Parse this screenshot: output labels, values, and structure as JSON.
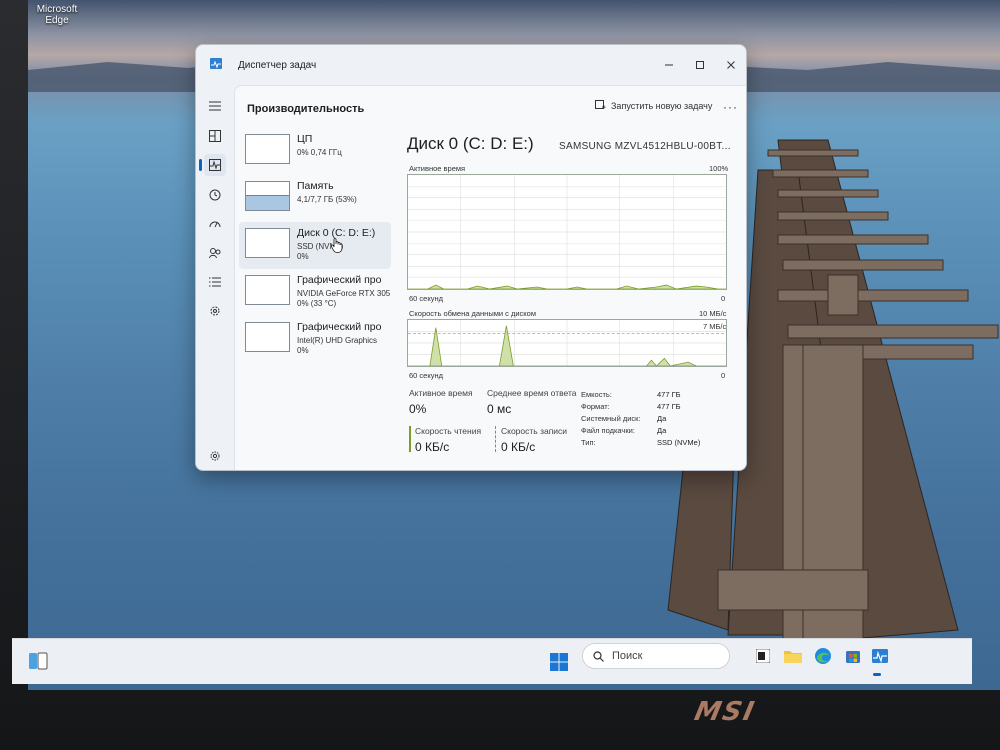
{
  "desktop": {
    "edge_label_1": "Microsoft",
    "edge_label_2": "Edge"
  },
  "taskmanager": {
    "title": "Диспетчер задач",
    "page_title": "Производительность",
    "run_task": "Запустить новую задачу",
    "more": "···",
    "resources": [
      {
        "name": "ЦП",
        "sub1": "0% 0,74 ГГц",
        "sub2": ""
      },
      {
        "name": "Память",
        "sub1": "4,1/7,7 ГБ (53%)",
        "sub2": "",
        "fill_fraction": 0.53
      },
      {
        "name": "Диск 0 (C: D: E:)",
        "sub1": "SSD (NVMe)",
        "sub2": "0%"
      },
      {
        "name": "Графический про",
        "sub1": "NVIDIA GeForce RTX 305",
        "sub2": "0%  (33 °C)"
      },
      {
        "name": "Графический про",
        "sub1": "Intel(R) UHD Graphics",
        "sub2": "0%"
      }
    ],
    "disk": {
      "title": "Диск 0 (C: D: E:)",
      "model": "SAMSUNG MZVL4512HBLU-00BT...",
      "graph1_label": "Активное время",
      "graph1_max": "100%",
      "graph1_xleft": "60 секунд",
      "graph1_xright": "0",
      "graph2_label": "Скорость обмена данными с диском",
      "graph2_max": "10 МБ/с",
      "graph2_sub": "7 МБ/с",
      "graph2_xleft": "60 секунд",
      "graph2_xright": "0",
      "active_time_label": "Активное время",
      "active_time_value": "0%",
      "avg_response_label": "Среднее время ответа",
      "avg_response_value": "0 мс",
      "read_label": "Скорость чтения",
      "read_value": "0 КБ/с",
      "write_label": "Скорость записи",
      "write_value": "0 КБ/с",
      "props": [
        {
          "key": "Емкость:",
          "value": "477 ГБ"
        },
        {
          "key": "Формат:",
          "value": "477 ГБ"
        },
        {
          "key": "Системный диск:",
          "value": "Да"
        },
        {
          "key": "Файл подкачки:",
          "value": "Да"
        },
        {
          "key": "Тип:",
          "value": "SSD (NVMe)"
        }
      ]
    }
  },
  "taskbar": {
    "search_placeholder": "Поиск"
  },
  "brand": "msi",
  "colors": {
    "accent": "#0a64c8",
    "graph_line": "#7c9c2c",
    "memory_fill": "#a9c6e3"
  }
}
